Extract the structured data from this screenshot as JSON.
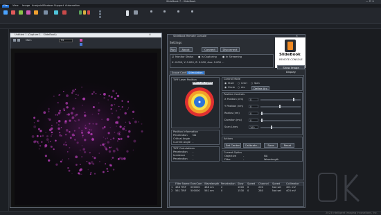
{
  "app": {
    "title": "SlideBook 7 - SlideBook",
    "status_right": "2023 Intelligent Imaging Innovations, Inc."
  },
  "ribbon": {
    "tabs": [
      {
        "label": "File",
        "active": true
      },
      {
        "label": "View",
        "active": false
      },
      {
        "label": "Image",
        "active": false
      },
      {
        "label": "Analysis",
        "active": false
      },
      {
        "label": "Windows",
        "active": false
      },
      {
        "label": "Support",
        "active": false
      },
      {
        "label": "Automation",
        "active": false
      }
    ]
  },
  "image_window": {
    "title": "Untitled 1 (Capture 1 - SlideBook)",
    "zoom": "Fit",
    "view_label": "Main"
  },
  "console": {
    "title": "SlideBook Remote Console",
    "settings_label": "Settings",
    "buttons": {
      "run": "Run",
      "about": "About",
      "connect": "Connect",
      "disconnect": "Disconnect"
    },
    "monitor_status_label": "Monitor Status",
    "capturing_label": "Is Capturing",
    "streaming_label": "In Streaming",
    "position_readout": "X: 0.000, Y: 0.000, Z: 0.000, Aux: 0.000 ...",
    "logo_title": "SlideBook",
    "logo_subtitle": "REMOTE CONSOLE",
    "logo_button": "Show Image Display",
    "tabs": [
      {
        "label": "Scope Control",
        "active": false
      },
      {
        "label": "Stimulation",
        "active": true
      }
    ],
    "laser_section": "TIRF Laser Position",
    "laser_readout": "Pos = (0, 0)um",
    "control_mode": {
      "label": "Control Mode",
      "options": [
        "Start",
        "Cntrl",
        "Spin",
        "Circle",
        "Arc"
      ],
      "define_button": "Define Arc"
    },
    "position_controls": {
      "label": "Position Controls",
      "rows": [
        {
          "label": "X Position (nm)",
          "value": "0"
        },
        {
          "label": "Y Position (nm)",
          "value": "0"
        },
        {
          "label": "Radius (nm)",
          "value": "0"
        },
        {
          "label": "Duration (ms)",
          "value": "0"
        },
        {
          "label": "Scan Lines",
          "value": "100"
        }
      ]
    },
    "actions": {
      "label": "Actions",
      "buttons": [
        "Set Center",
        "Calibrate...",
        "Save",
        "Reset"
      ]
    },
    "current_optics": {
      "label": "Current Optics",
      "objective_label": "Objective",
      "objective_value": "-",
      "filter_label": "Filter",
      "filter_value": "-",
      "na_label": "NA",
      "wavelength_label": "Wavelength"
    },
    "position_info": {
      "label": "Position Information",
      "rows": [
        {
          "label": "Penetration",
          "value": "NA"
        },
        {
          "label": "Critical Angle",
          "value": "-"
        },
        {
          "label": "Current Angle",
          "value": "-"
        }
      ]
    },
    "tirf_calc": {
      "label": "TIRF Calculations",
      "rows": [
        {
          "label": "Penetration",
          "value": "-"
        },
        {
          "label": "Incidence",
          "value": "-"
        },
        {
          "label": "Penetration",
          "value": "-"
        }
      ]
    },
    "table": {
      "headers": [
        "Filter Name",
        "ExecCom",
        "Wavelength",
        "Penetration",
        "Slow",
        "Speed",
        "Channel",
        "Speed",
        "Collimator"
      ],
      "rows": [
        [
          "488 TIRF",
          "000000",
          "488 nm",
          "2",
          "1000",
          "0",
          "200",
          "Not set",
          "401 mV"
        ],
        [
          "561 TIRF",
          "500000",
          "561 nm",
          "0",
          "1530",
          "0",
          "280",
          "Not set",
          "403 mV"
        ]
      ]
    }
  }
}
